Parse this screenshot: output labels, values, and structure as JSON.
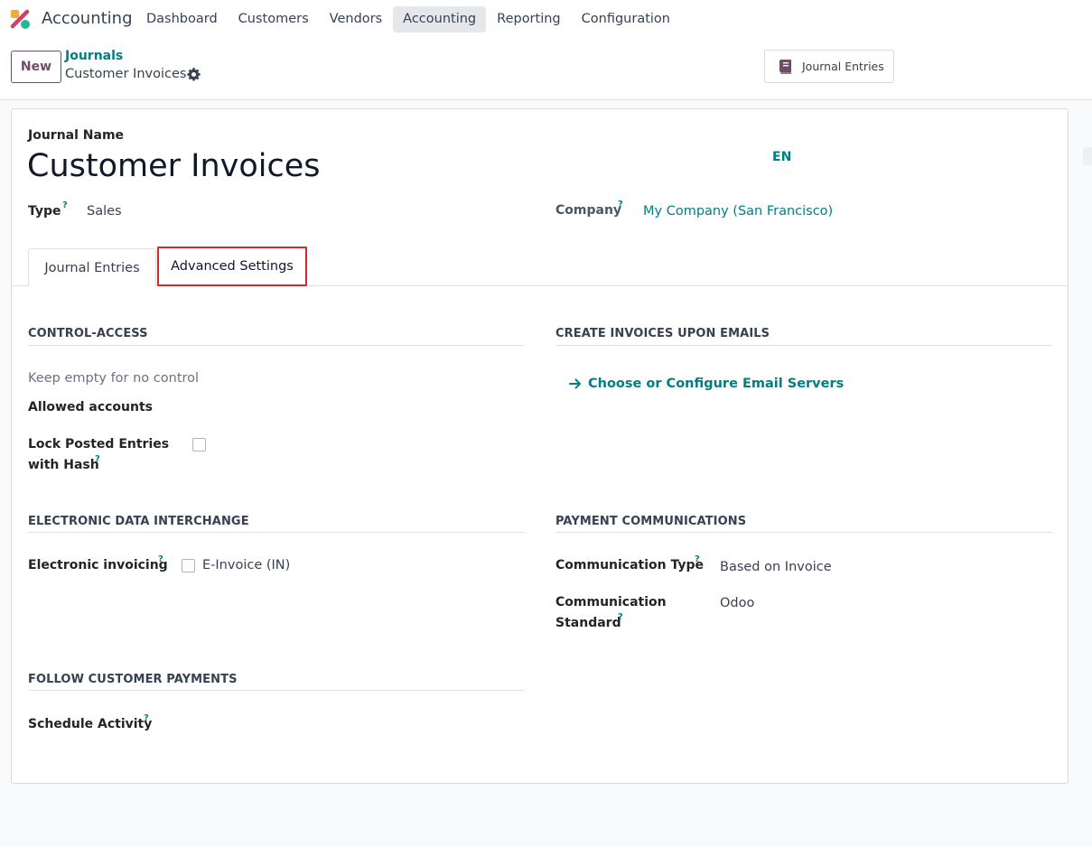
{
  "navbar": {
    "app_name": "Accounting",
    "menu": [
      "Dashboard",
      "Customers",
      "Vendors",
      "Accounting",
      "Reporting",
      "Configuration"
    ],
    "active_menu": "Accounting"
  },
  "control_panel": {
    "new_label": "New",
    "breadcrumb_parent": "Journals",
    "breadcrumb_current": "Customer Invoices",
    "smart_button_label": "Journal Entries"
  },
  "form": {
    "name_label": "Journal Name",
    "name_value": "Customer Invoices",
    "lang_label": "EN",
    "type_label": "Type",
    "type_value": "Sales",
    "company_label": "Company",
    "company_value": "My Company (San Francisco)",
    "help_mark": "?",
    "tabs": [
      "Journal Entries",
      "Advanced Settings"
    ],
    "active_tab": "Advanced Settings"
  },
  "advanced": {
    "control_access": {
      "title": "CONTROL-ACCESS",
      "placeholder_hint": "Keep empty for no control",
      "allowed_accounts_label": "Allowed accounts",
      "lock_label_line1": "Lock Posted Entries",
      "lock_label_line2": "with Hash",
      "lock_checked": false
    },
    "create_invoices": {
      "title": "CREATE INVOICES UPON EMAILS",
      "link_label": "Choose or Configure Email Servers"
    },
    "edi": {
      "title": "ELECTRONIC DATA INTERCHANGE",
      "einvoicing_label": "Electronic invoicing",
      "einvoice_option": "E-Invoice (IN)",
      "einvoice_checked": false
    },
    "payment_comm": {
      "title": "PAYMENT COMMUNICATIONS",
      "comm_type_label": "Communication Type",
      "comm_type_value": "Based on Invoice",
      "comm_standard_label_line1": "Communication",
      "comm_standard_label_line2": "Standard",
      "comm_standard_value": "Odoo"
    },
    "follow_payments": {
      "title": "FOLLOW CUSTOMER PAYMENTS",
      "schedule_label": "Schedule Activity"
    }
  },
  "colors": {
    "brand": "#714b67",
    "link": "#017e84",
    "highlight_border": "#d9262a"
  }
}
